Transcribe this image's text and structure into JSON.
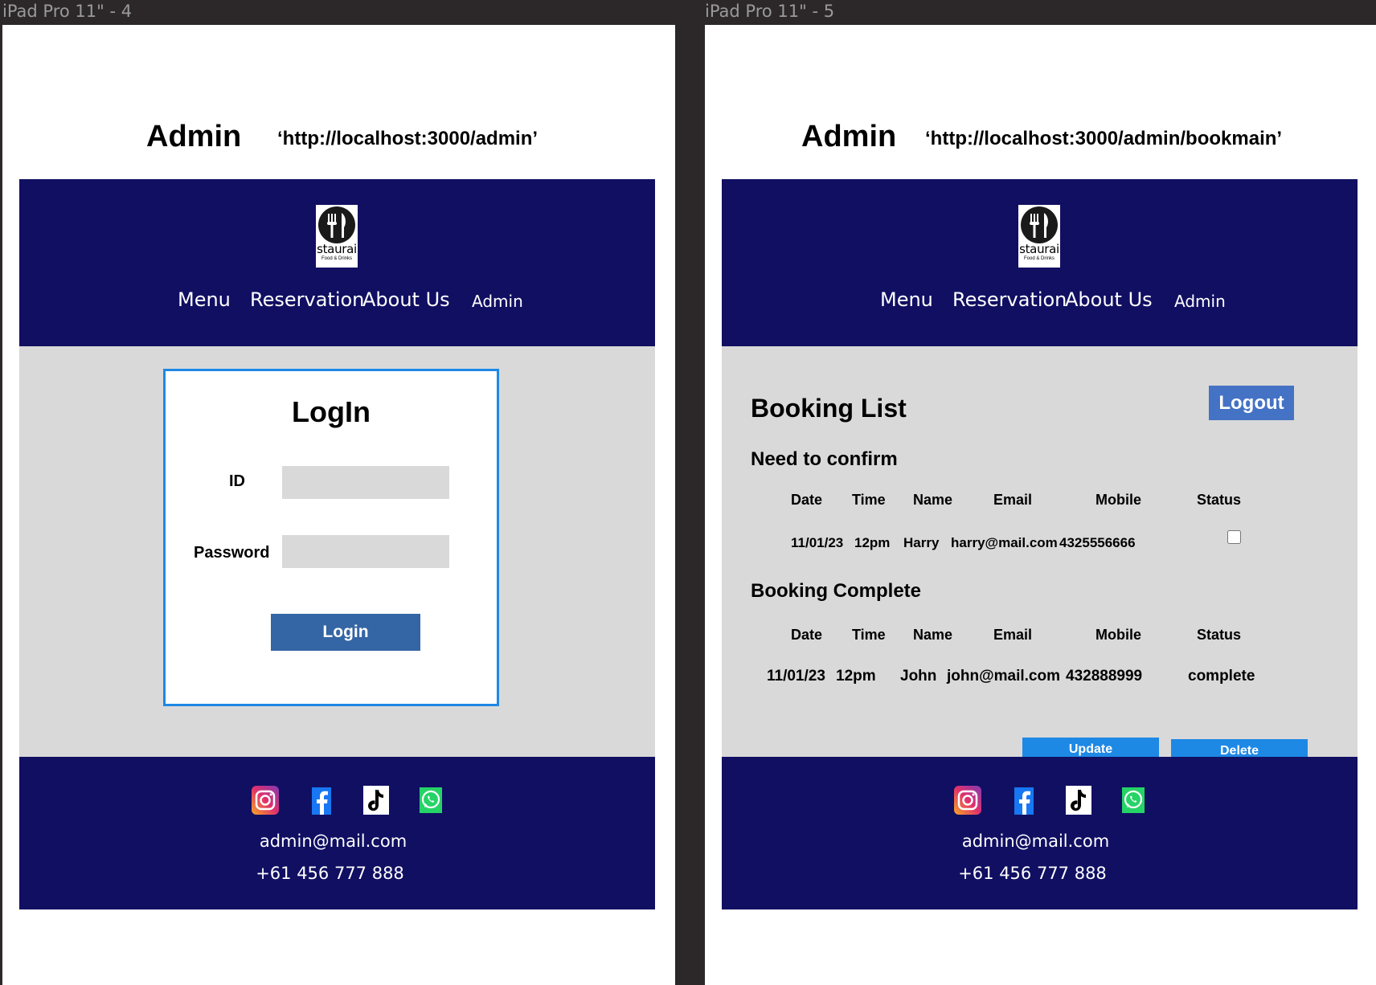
{
  "frames": [
    {
      "label": "iPad Pro 11\" - 4",
      "title": "Admin",
      "url": "‘http://localhost:3000/admin’"
    },
    {
      "label": "iPad Pro 11\" - 5",
      "title": "Admin",
      "url": "‘http://localhost:3000/admin/bookmain’"
    }
  ],
  "header": {
    "logo_text": "staurai",
    "logo_sub": "Food & Drinks",
    "nav": [
      "Menu",
      "Reservation",
      "About Us",
      "Admin"
    ]
  },
  "login": {
    "title": "LogIn",
    "id_label": "ID",
    "id_value": "",
    "password_label": "Password",
    "password_value": "",
    "button": "Login"
  },
  "booking": {
    "title": "Booking List",
    "logout": "Logout",
    "confirm_heading": "Need to confirm",
    "complete_heading": "Booking Complete",
    "columns": [
      "Date",
      "Time",
      "Name",
      "Email",
      "Mobile",
      "Status"
    ],
    "confirm_rows": [
      {
        "date": "11/01/23",
        "time": "12pm",
        "name": "Harry",
        "email": "harry@mail.com",
        "mobile": "4325556666",
        "status": ""
      }
    ],
    "complete_rows": [
      {
        "date": "11/01/23",
        "time": "12pm",
        "name": "John",
        "email": "john@mail.com",
        "mobile": "432888999",
        "status": "complete"
      }
    ],
    "update": "Update",
    "delete": "Delete"
  },
  "footer": {
    "icons": [
      "instagram-icon",
      "facebook-icon",
      "tiktok-icon",
      "whatsapp-icon"
    ],
    "email": "admin@mail.com",
    "phone": "+61 456 777 888"
  },
  "colors": {
    "header_bg": "#110f62",
    "content_bg": "#d9d9d9",
    "accent": "#1e88e5",
    "login_button": "#3465a4",
    "logout_button": "#4472c4"
  }
}
